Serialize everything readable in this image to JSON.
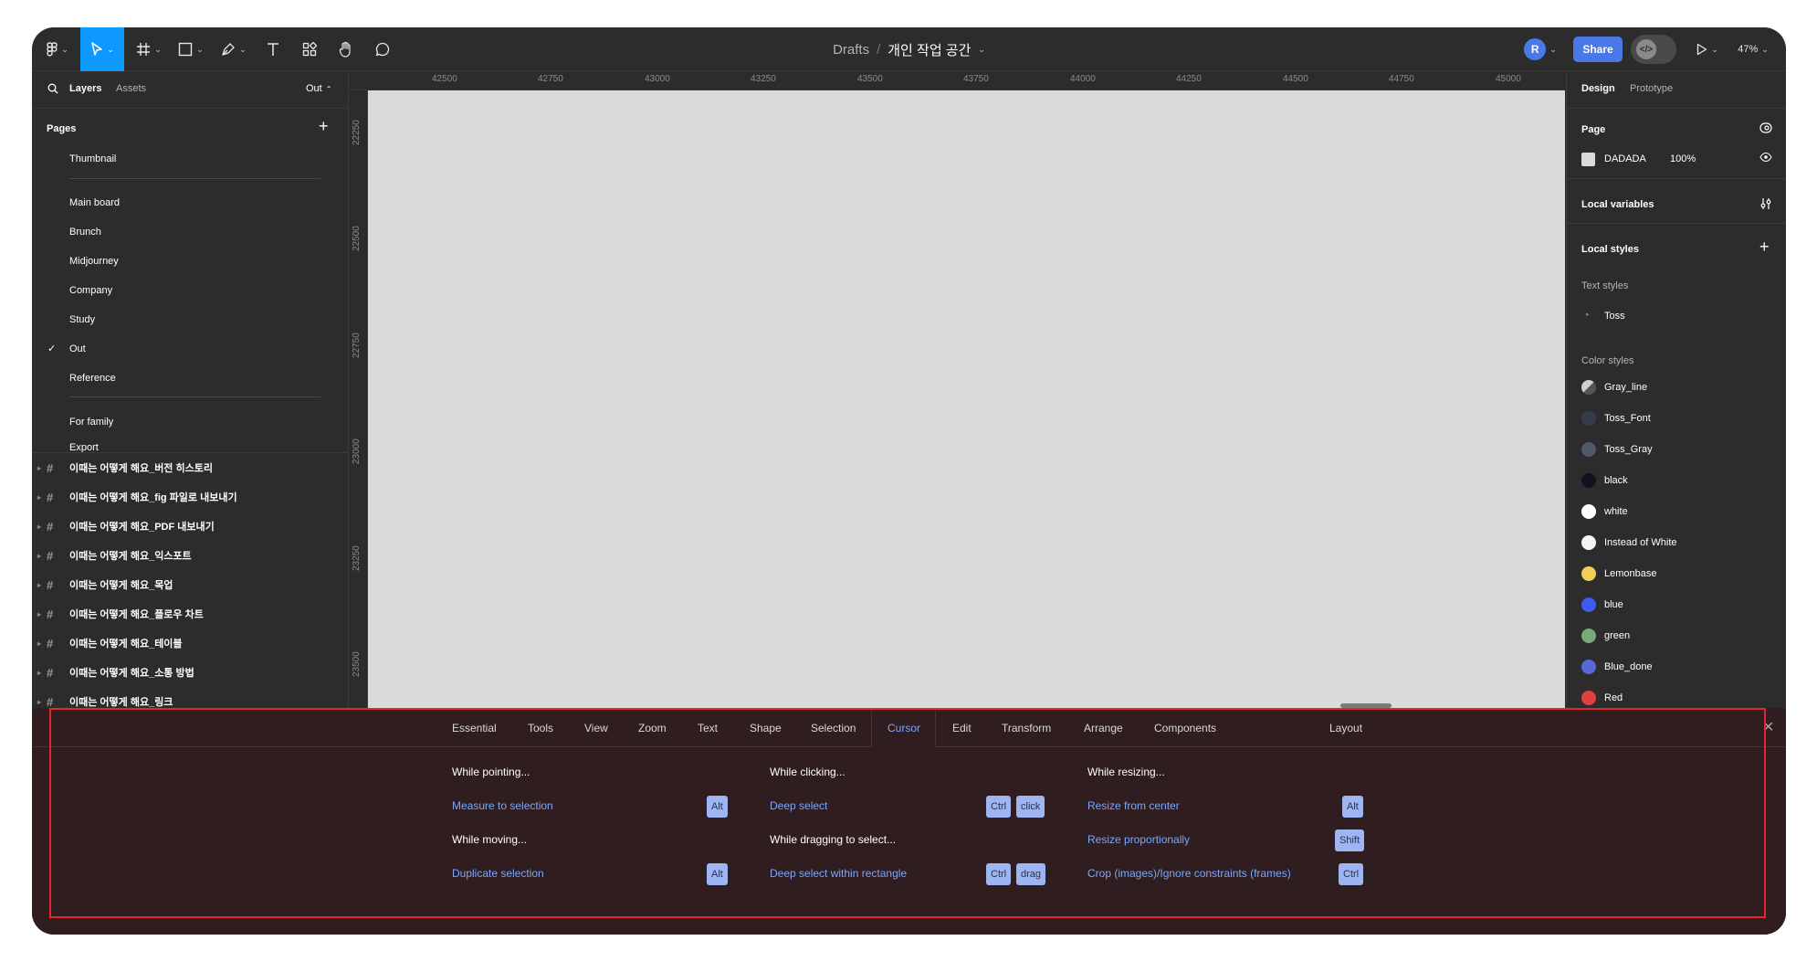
{
  "topbar": {
    "breadcrumb_root": "Drafts",
    "breadcrumb_sep": "/",
    "file_name": "개인 작업 공간",
    "avatar_initial": "R",
    "share_label": "Share",
    "zoom_label": "47%"
  },
  "ruler": {
    "top": [
      "42500",
      "42750",
      "43000",
      "43250",
      "43500",
      "43750",
      "44000",
      "44250",
      "44500",
      "44750",
      "45000"
    ],
    "left": [
      "22250",
      "22500",
      "22750",
      "23000",
      "23250",
      "23500"
    ]
  },
  "left_panel": {
    "tab_layers": "Layers",
    "tab_assets": "Assets",
    "current_page": "Out",
    "pages_header": "Pages",
    "pages": [
      "Thumbnail",
      "Main board",
      "Brunch",
      "Midjourney",
      "Company",
      "Study",
      "Out",
      "Reference",
      "For family",
      "Export"
    ],
    "check": "✓",
    "layers": [
      "이때는 어떻게 해요_버전 히스토리",
      "이때는 어떻게 해요_fig 파일로 내보내기",
      "이때는 어떻게 해요_PDF 내보내기",
      "이때는 어떻게 해요_익스포트",
      "이때는 어떻게 해요_목업",
      "이때는 어떻게 해요_플로우 차트",
      "이때는 어떻게 해요_테이블",
      "이때는 어떻게 해요_소통 방법",
      "이때는 어떻게 해요_링크"
    ]
  },
  "right_panel": {
    "tab_design": "Design",
    "tab_prototype": "Prototype",
    "page_header": "Page",
    "page_color": "DADADA",
    "page_opacity": "100%",
    "local_variables": "Local variables",
    "local_styles": "Local styles",
    "text_styles_header": "Text styles",
    "text_styles": [
      "Toss"
    ],
    "color_styles_header": "Color styles",
    "color_styles": [
      {
        "name": "Gray_line",
        "color": "#9a9a9a"
      },
      {
        "name": "Toss_Font",
        "color": "#333d4b"
      },
      {
        "name": "Toss_Gray",
        "color": "#4e5968"
      },
      {
        "name": "black",
        "color": "#111122"
      },
      {
        "name": "white",
        "color": "#ffffff"
      },
      {
        "name": "Instead of White",
        "color": "#f5f5f5"
      },
      {
        "name": "Lemonbase",
        "color": "#f2cf5b"
      },
      {
        "name": "blue",
        "color": "#3c5cf2"
      },
      {
        "name": "green",
        "color": "#7aa87a"
      },
      {
        "name": "Blue_done",
        "color": "#5968d9"
      },
      {
        "name": "Red",
        "color": "#e04040"
      }
    ]
  },
  "shortcuts": {
    "tabs": [
      "Essential",
      "Tools",
      "View",
      "Zoom",
      "Text",
      "Shape",
      "Selection",
      "Cursor",
      "Edit",
      "Transform",
      "Arrange",
      "Components",
      "Layout"
    ],
    "active_tab": "Cursor",
    "col1": {
      "h1": "While pointing...",
      "a1": "Measure to selection",
      "k1": "Alt",
      "h2": "While moving...",
      "a2": "Duplicate selection",
      "k2": "Alt"
    },
    "col2": {
      "h1": "While clicking...",
      "a1": "Deep select",
      "k1a": "Ctrl",
      "k1b": "click",
      "h2": "While dragging to select...",
      "a2": "Deep select within rectangle",
      "k2a": "Ctrl",
      "k2b": "drag"
    },
    "col3": {
      "h1": "While resizing...",
      "a1": "Resize from center",
      "k1": "Alt",
      "a2": "Resize proportionally",
      "k2": "Shift",
      "a3": "Crop (images)/Ignore constraints (frames)",
      "k3": "Ctrl"
    }
  }
}
